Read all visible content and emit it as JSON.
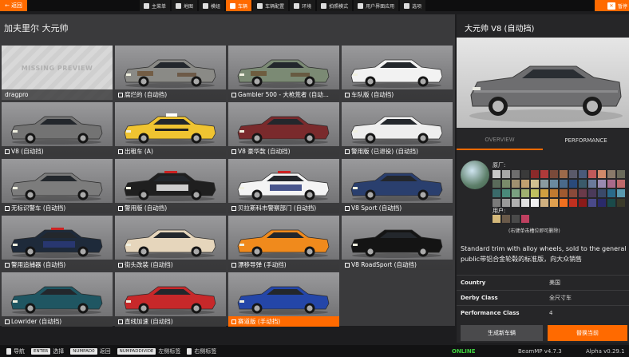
{
  "topbar": {
    "back_label": "返回",
    "menu": [
      {
        "label": "主菜单",
        "icon": "home-icon",
        "active": false
      },
      {
        "label": "地图",
        "icon": "map-icon",
        "active": false
      },
      {
        "label": "模组",
        "icon": "mods-icon",
        "active": false
      },
      {
        "label": "车辆",
        "icon": "car-icon",
        "active": true
      },
      {
        "label": "车辆配置",
        "icon": "vehicle-config-icon",
        "active": false
      },
      {
        "label": "环境",
        "icon": "environment-icon",
        "active": false
      },
      {
        "label": "拍照模式",
        "icon": "camera-icon",
        "active": false
      },
      {
        "label": "用户界面应用",
        "icon": "ui-apps-icon",
        "active": false
      },
      {
        "label": "选项",
        "icon": "options-icon",
        "active": false
      }
    ],
    "right_label": "暂停"
  },
  "left": {
    "title": "加夫里尔 大元帅",
    "missing_preview": "MISSING PREVIEW",
    "cards": [
      {
        "label": "dragpro",
        "missing": true,
        "selected": false,
        "color": "#d6d6d6",
        "style": "none"
      },
      {
        "label": "腐烂的 (自动挡)",
        "missing": false,
        "selected": false,
        "color": "#8a8a86",
        "style": "rusty"
      },
      {
        "label": "Gambler 500 - 大枪荒者 (自动...",
        "missing": false,
        "selected": false,
        "color": "#7b8a74",
        "style": "rusty"
      },
      {
        "label": "车队版 (自动挡)",
        "missing": false,
        "selected": false,
        "color": "#f2f2f2",
        "style": "plain"
      },
      {
        "label": "V8 (自动挡)",
        "missing": false,
        "selected": false,
        "color": "#737373",
        "style": "plain"
      },
      {
        "label": "出租车 (A)",
        "missing": false,
        "selected": false,
        "color": "#f0c431",
        "style": "taxi"
      },
      {
        "label": "V8 豪华款 (自动挡)",
        "missing": false,
        "selected": false,
        "color": "#7a2a2c",
        "style": "plain"
      },
      {
        "label": "警用版 (已退役) (自动挡)",
        "missing": false,
        "selected": false,
        "color": "#eeeeee",
        "style": "plain"
      },
      {
        "label": "无标识警车 (自动挡)",
        "missing": false,
        "selected": false,
        "color": "#7c7c7c",
        "style": "plain"
      },
      {
        "label": "警用版 (自动挡)",
        "missing": false,
        "selected": false,
        "color": "#1f1f1f",
        "style": "police"
      },
      {
        "label": "贝拉斯科市警察部门 (自动挡)",
        "missing": false,
        "selected": false,
        "color": "#f4f4f4",
        "style": "police"
      },
      {
        "label": "V8 Sport (自动挡)",
        "missing": false,
        "selected": false,
        "color": "#2a3f6e",
        "style": "plain"
      },
      {
        "label": "警用追捕器 (自动挡)",
        "missing": false,
        "selected": false,
        "color": "#1e2a3a",
        "style": "police"
      },
      {
        "label": "街头改装 (自动挡)",
        "missing": false,
        "selected": false,
        "color": "#e6d6bc",
        "style": "plain"
      },
      {
        "label": "漂移导弹 (手动挡)",
        "missing": false,
        "selected": false,
        "color": "#f08a1c",
        "style": "plain"
      },
      {
        "label": "V8 RoadSport (自动挡)",
        "missing": false,
        "selected": false,
        "color": "#141414",
        "style": "plain"
      },
      {
        "label": "Lowrider (自动挡)",
        "missing": false,
        "selected": false,
        "color": "#1f5662",
        "style": "plain"
      },
      {
        "label": "直线加速 (自动挡)",
        "missing": false,
        "selected": false,
        "color": "#c7282a",
        "style": "plain"
      },
      {
        "label": "赛道版 (手动挡)",
        "missing": false,
        "selected": true,
        "color": "#2446a8",
        "style": "plain"
      }
    ]
  },
  "right": {
    "title": "大元帅 V8 (自动挡)",
    "car_color": "#6e6e70",
    "tabs": [
      "OVERVIEW",
      "PERFORMANCE"
    ],
    "factory_label": "原厂:",
    "factory_colors": [
      "#c8c8c8",
      "#a8a8a8",
      "#6e6e6e",
      "#3a3a3a",
      "#8c2a2a",
      "#b03a3a",
      "#7a4a3a",
      "#9c6a4a",
      "#5a5a6a",
      "#4a5a7a",
      "#c05a5a",
      "#d08a6a",
      "#8a7a6a",
      "#6a6a5a",
      "#5a6a5a",
      "#7a8a6a",
      "#a09070",
      "#c0a070",
      "#d0c090",
      "#8a9aa0",
      "#6a8aa0",
      "#4a6a8a",
      "#2a4a7a",
      "#3a5a6a",
      "#6a7a9a",
      "#9a8ab0",
      "#aa6a8a",
      "#c06a6a",
      "#3a6a6a",
      "#4a8a7a",
      "#7aa080",
      "#a0b070",
      "#c0c060",
      "#d0a040",
      "#c07a30",
      "#a05a30",
      "#8a4a3a",
      "#6a3a4a",
      "#4a3a5a",
      "#3a4a6a",
      "#2a6a8a",
      "#5a9ab0",
      "#7a7a7a",
      "#9a9a9a",
      "#b0b0b0",
      "#e0e0e0",
      "#f0f0f0",
      "#d0b080",
      "#e0a050",
      "#f07020",
      "#c03020",
      "#8a1a1a",
      "#4a4a8a",
      "#2a2a6a",
      "#1a4a4a",
      "#3a3a2a"
    ],
    "user_label": "用户:",
    "user_colors": [
      "#d4b87a",
      "#6a5a4a",
      "#4a4a4a",
      "#c04060"
    ],
    "user_hint": "(右键单击槽位即可删除)",
    "description": "Standard trim with alloy wheels, sold to the general public带铝合金轮毂的标准版，向大众销售",
    "info": [
      {
        "key": "Country",
        "value": "美国"
      },
      {
        "key": "Derby Class",
        "value": "全尺寸车"
      },
      {
        "key": "Performance Class",
        "value": "4"
      }
    ],
    "spawn_new": "生成新车辆",
    "replace_current": "替换当前"
  },
  "bottombar": {
    "hints": [
      {
        "key": "",
        "label": "导航"
      },
      {
        "key": "ENTER",
        "label": "选择"
      },
      {
        "key": "NUMPAD0",
        "label": "返回"
      },
      {
        "key": "NUMPADDIVIDE",
        "label": "左侧标签"
      },
      {
        "key": "",
        "label": "右侧标签"
      }
    ],
    "status": "ONLINE",
    "beammp_version": "BeamMP v4.7.3",
    "game_version": "Alpha v0.29.1"
  }
}
